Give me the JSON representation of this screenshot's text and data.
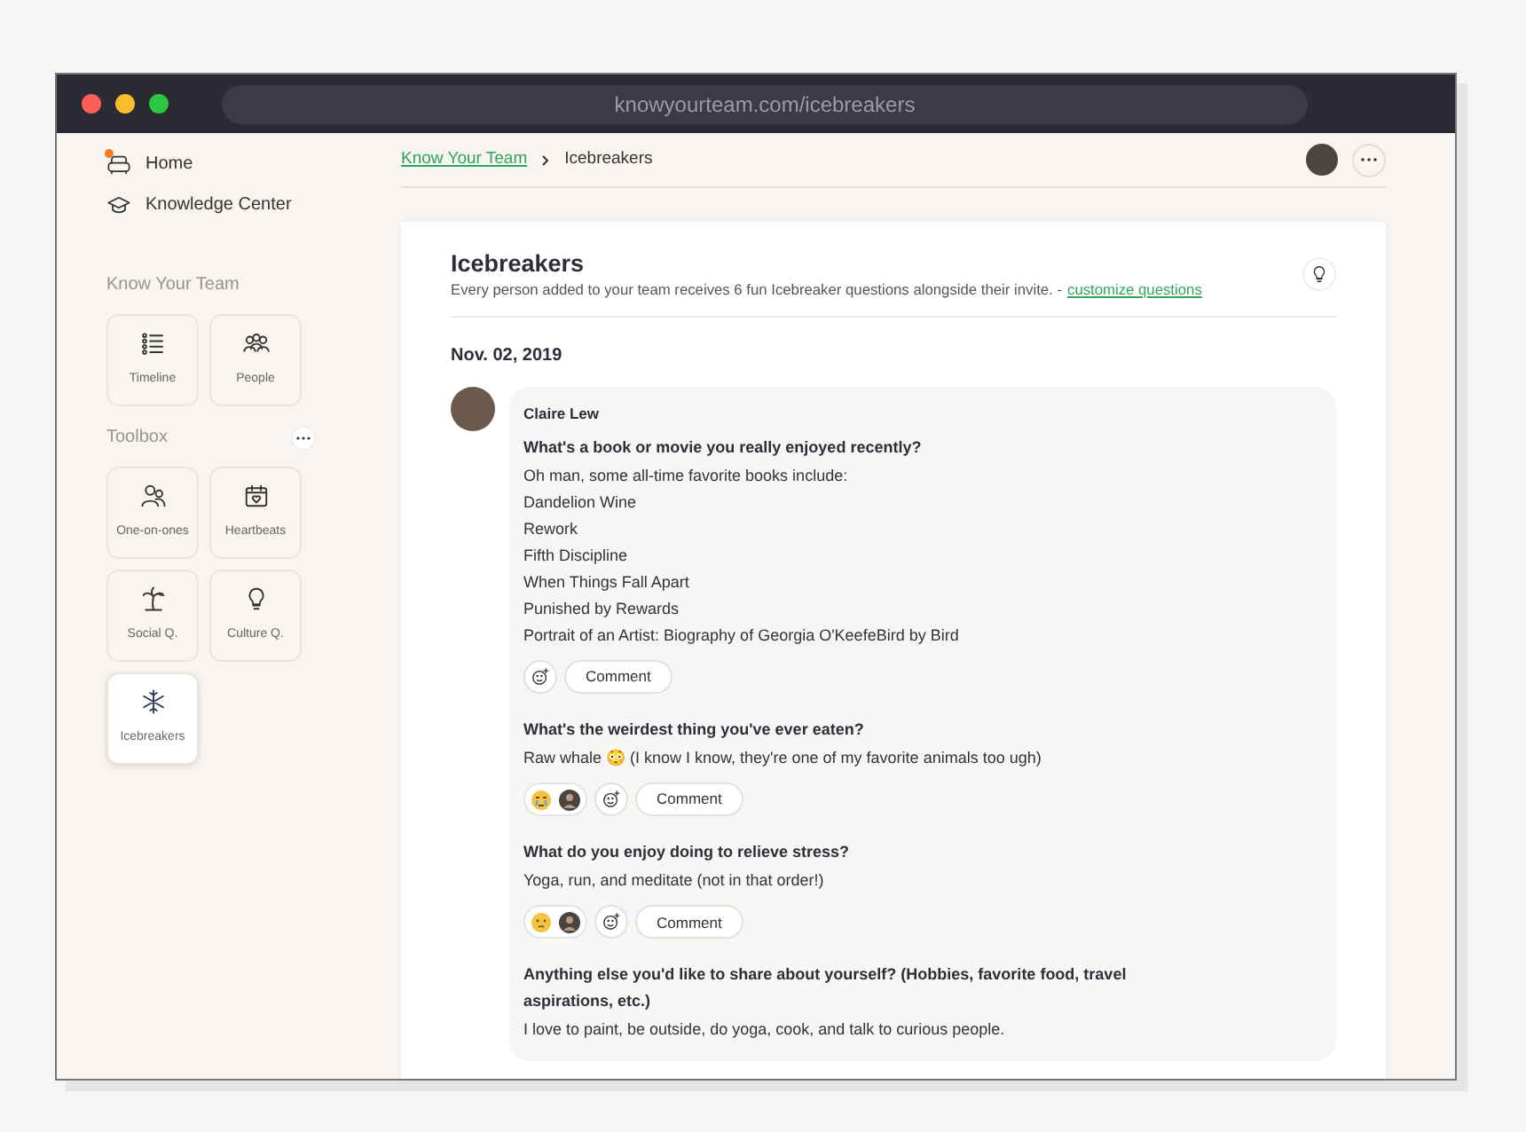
{
  "browser": {
    "url": "knowyourteam.com/icebreakers"
  },
  "nav": [
    {
      "label": "Home",
      "kind": "home",
      "notification": true
    },
    {
      "label": "Knowledge Center",
      "kind": "knowledge",
      "notification": false
    }
  ],
  "sections": [
    {
      "title": "Know Your Team",
      "tiles": [
        {
          "label": "Timeline",
          "kind": "timeline",
          "selected": false
        },
        {
          "label": "People",
          "kind": "people",
          "selected": false
        }
      ]
    },
    {
      "title": "Toolbox",
      "more_button": true,
      "tiles": [
        {
          "label": "One-on-ones",
          "kind": "oneonone",
          "selected": false
        },
        {
          "label": "Heartbeats",
          "kind": "heartbeats",
          "selected": false
        },
        {
          "label": "Social Q.",
          "kind": "social",
          "selected": false
        },
        {
          "label": "Culture Q.",
          "kind": "culture",
          "selected": false
        },
        {
          "label": "Icebreakers",
          "kind": "icebreakers",
          "selected": true
        }
      ]
    }
  ],
  "breadcrumb": [
    {
      "label": "Know Your Team",
      "kind": "link"
    },
    {
      "label": "Icebreakers",
      "kind": "current"
    }
  ],
  "page": {
    "title": "Icebreakers",
    "description": "Every person added to your team receives 6 fun Icebreaker questions alongside their invite. -",
    "link": "customize questions"
  },
  "date": "Nov. 02, 2019",
  "post": {
    "author": "Claire Lew",
    "answers": [
      {
        "question": "What's a book or movie you really enjoyed recently?",
        "lines": [
          "Oh man, some all-time favorite books include:",
          "Dandelion Wine",
          "Rework",
          "Fifth Discipline",
          "When Things Fall Apart",
          "Punished by Rewards",
          "Portrait of an Artist: Biography of Georgia O'KeefeBird by Bird"
        ],
        "comment_button": "Comment"
      },
      {
        "question": "What's the weirdest thing you've ever eaten?",
        "lines": [
          "Raw whale 😳 (I know I know, they're one of my favorite animals too ugh)"
        ],
        "reactions": [
          {
            "kind": "crying"
          },
          {
            "kind": "avatar"
          }
        ],
        "comment_button": "Comment"
      },
      {
        "question": "What do you enjoy doing to relieve stress?",
        "lines": [
          "Yoga, run, and meditate (not in that order!)"
        ],
        "reactions": [
          {
            "kind": "shy"
          },
          {
            "kind": "avatar"
          }
        ],
        "comment_button": "Comment"
      },
      {
        "question": "Anything else you'd like to share about yourself? (Hobbies, favorite food, travel aspirations, etc.)",
        "lines": [
          "I love to paint, be outside, do yoga, cook, and talk to curious people."
        ]
      }
    ]
  }
}
